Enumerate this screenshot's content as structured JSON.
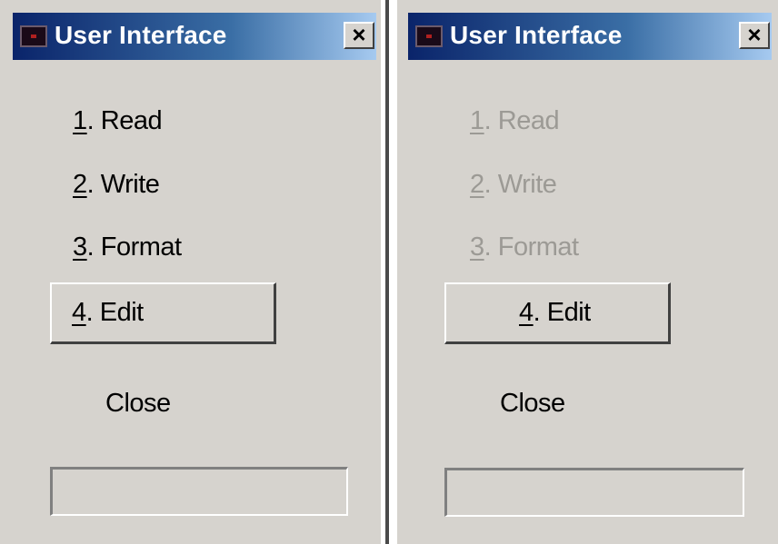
{
  "windows": [
    {
      "title": "User Interface",
      "close_glyph": "×",
      "icon": "app-icon",
      "items_enabled": true,
      "items": [
        {
          "num": "1",
          "label": ". Read"
        },
        {
          "num": "2",
          "label": ". Write"
        },
        {
          "num": "3",
          "label": ". Format"
        }
      ],
      "edit": {
        "num": "4",
        "label": ". Edit"
      },
      "close_label": "Close",
      "status_value": ""
    },
    {
      "title": "User Interface",
      "close_glyph": "×",
      "icon": "app-icon",
      "items_enabled": false,
      "items": [
        {
          "num": "1",
          "label": ". Read"
        },
        {
          "num": "2",
          "label": ". Write"
        },
        {
          "num": "3",
          "label": ". Format"
        }
      ],
      "edit": {
        "num": "4",
        "label": ". Edit"
      },
      "close_label": "Close",
      "status_value": ""
    }
  ],
  "colors": {
    "window_bg": "#d6d3ce",
    "title_gradient_start": "#0a246a",
    "title_gradient_end": "#a6caf0",
    "disabled_text": "#9c9a95"
  }
}
